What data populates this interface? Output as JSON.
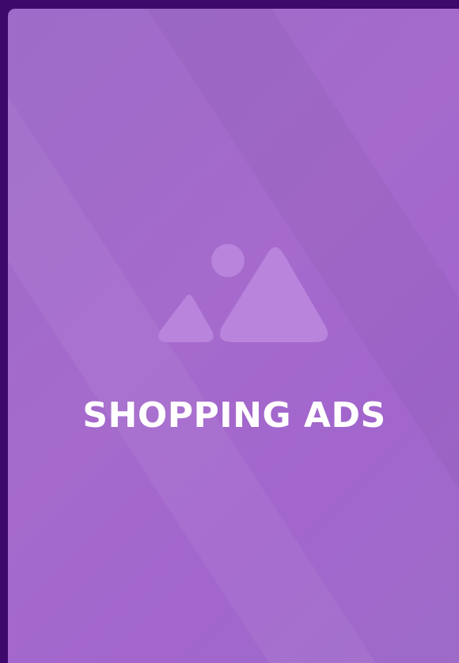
{
  "card": {
    "title": "SHOPPING ADS",
    "icon": "image-placeholder-icon"
  },
  "colors": {
    "background": "#3d0a6c",
    "card": "#a26acb",
    "icon": "#b884dc",
    "title": "#ffffff"
  }
}
